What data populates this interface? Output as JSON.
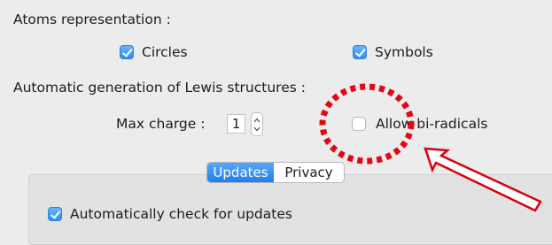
{
  "atoms": {
    "heading": "Atoms representation :",
    "circles_label": "Circles",
    "circles_checked": true,
    "symbols_label": "Symbols",
    "symbols_checked": true
  },
  "lewis": {
    "heading": "Automatic generation of Lewis structures :",
    "max_charge_label": "Max charge :",
    "max_charge_value": "1",
    "biradicals_label": "Allow bi-radicals",
    "biradicals_checked": false
  },
  "tabs": [
    {
      "label": "Updates",
      "active": true
    },
    {
      "label": "Privacy",
      "active": false
    }
  ],
  "updates": {
    "auto_check_label": "Automatically check for updates",
    "auto_check_checked": true
  },
  "annotation": {
    "highlight_color": "#e30613",
    "arrow_color": "#d9000d"
  },
  "colors": {
    "accent": "#2d8ef3",
    "background": "#ececec"
  }
}
